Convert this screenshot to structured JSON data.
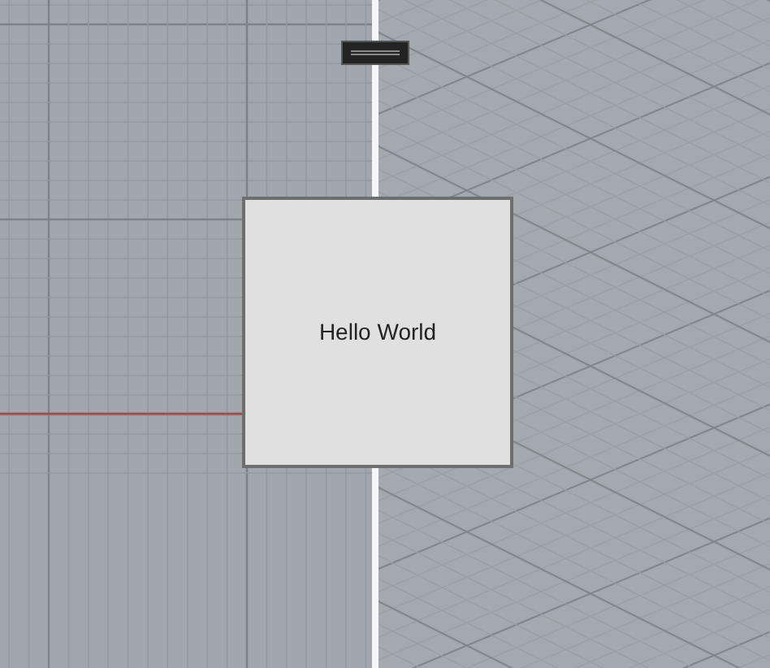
{
  "dialog": {
    "text": "Hello World"
  }
}
